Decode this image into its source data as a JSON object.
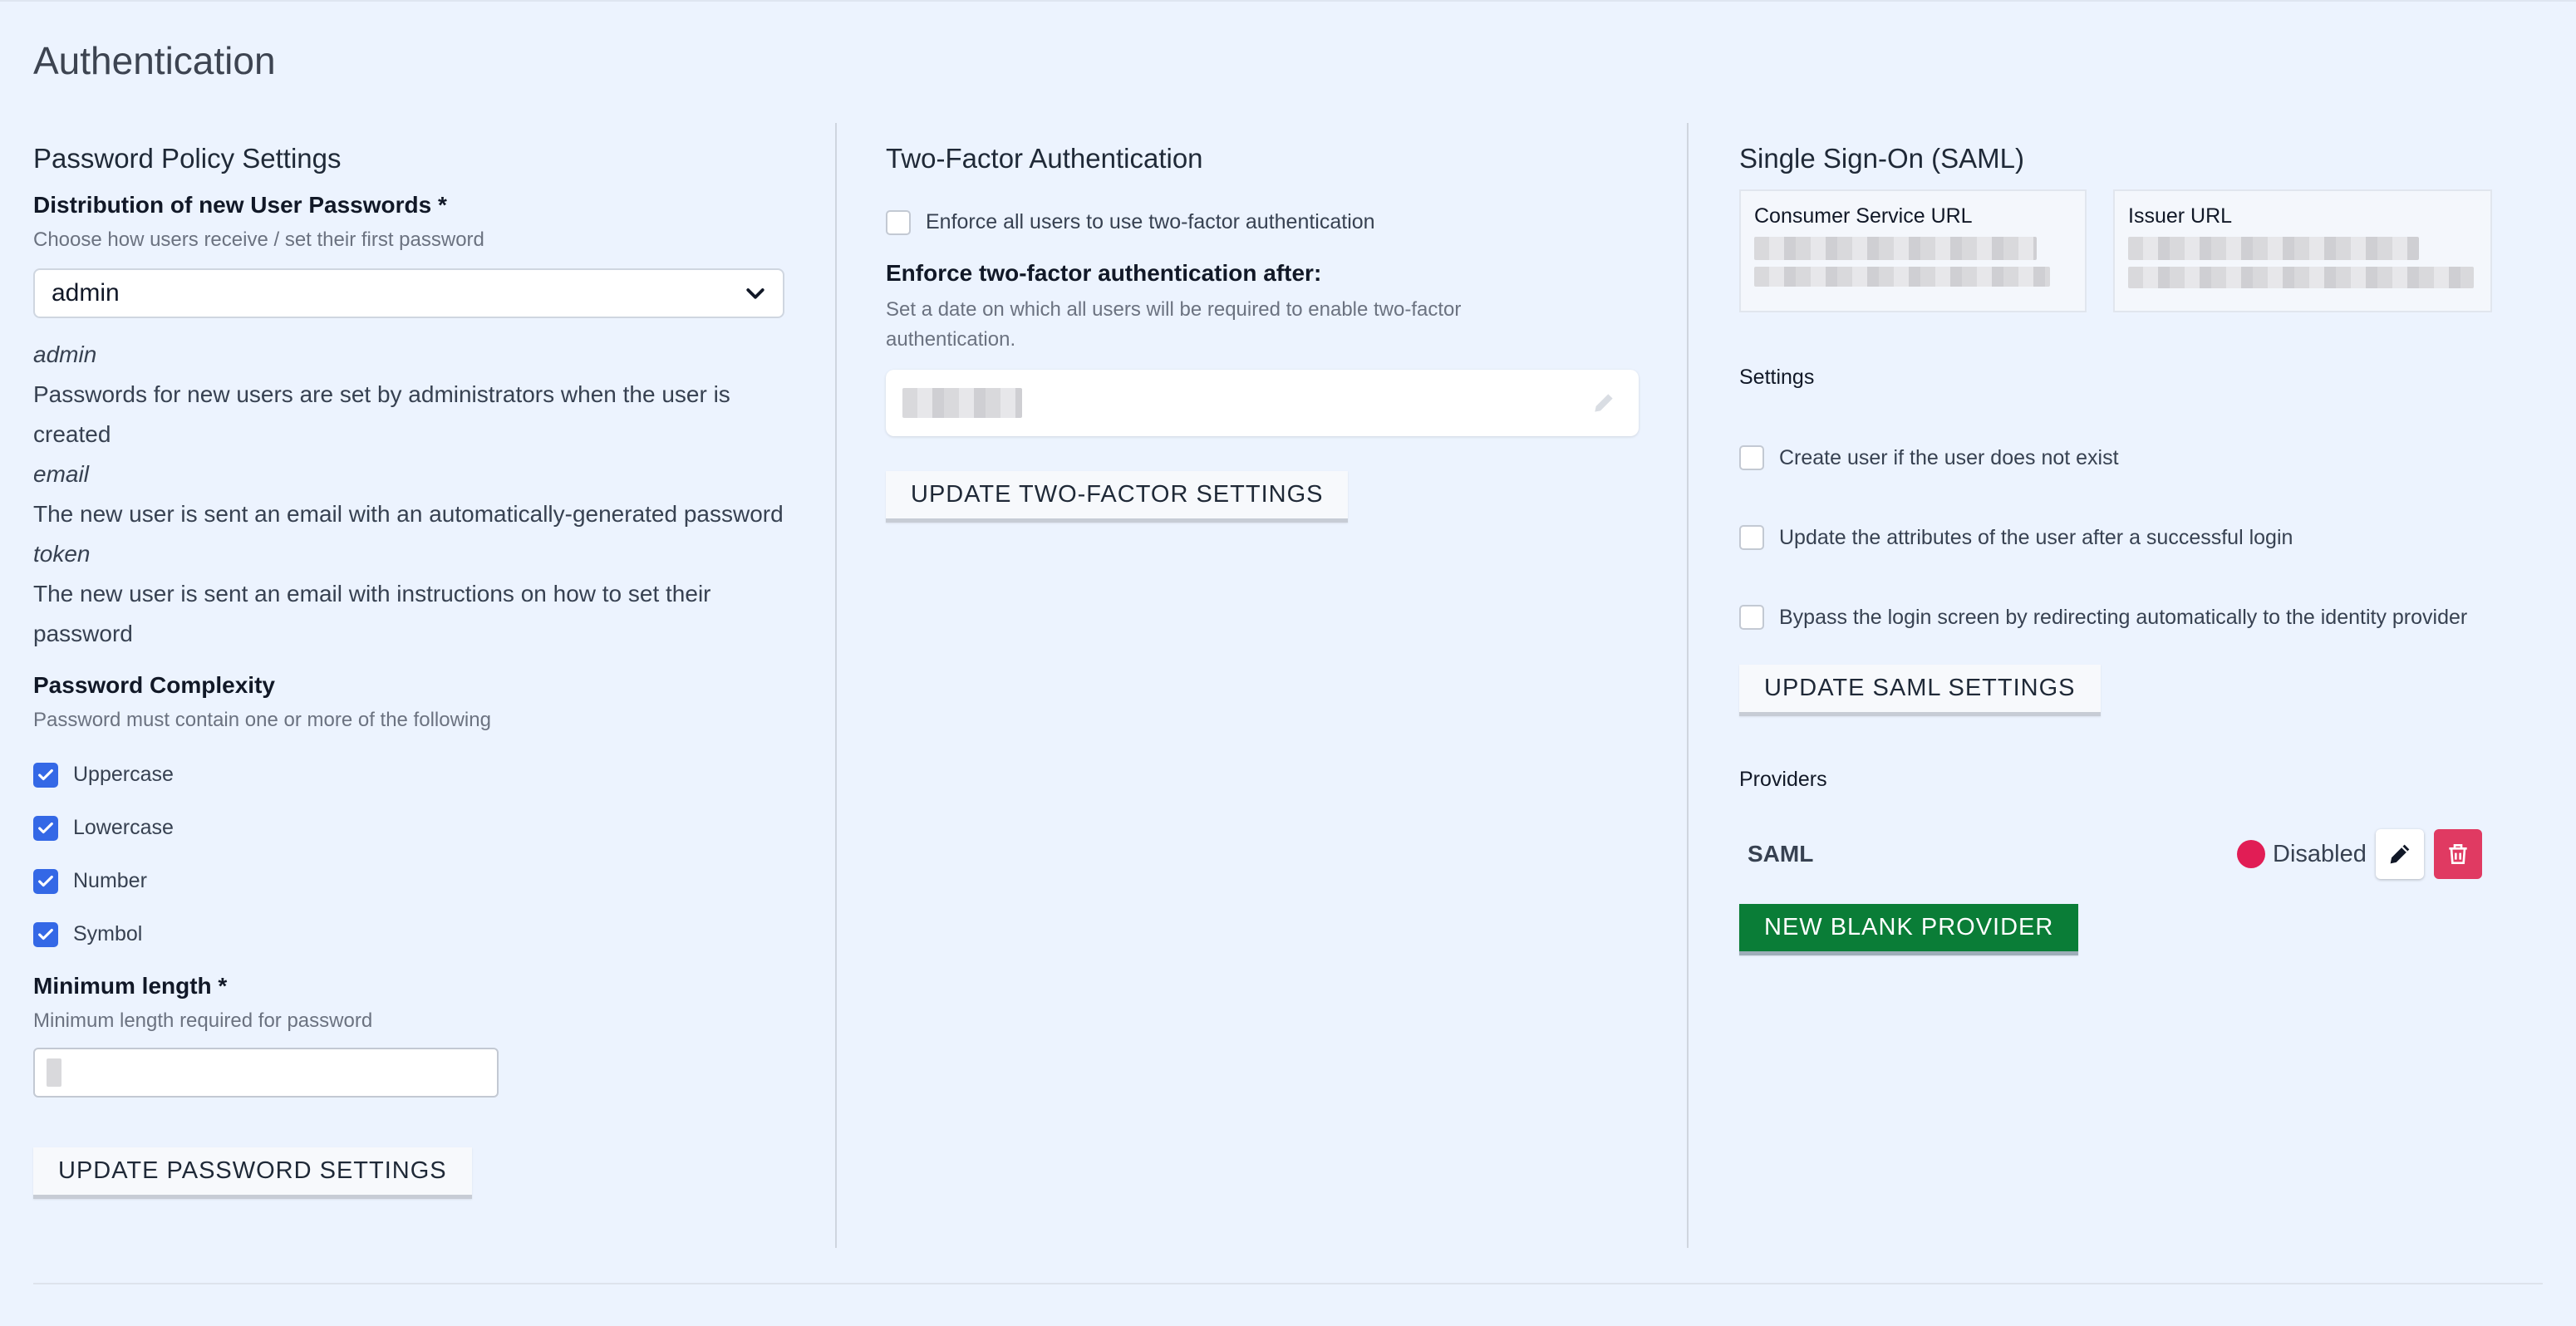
{
  "page": {
    "title": "Authentication"
  },
  "password_policy": {
    "title": "Password Policy Settings",
    "distribution_label": "Distribution of new User Passwords *",
    "distribution_help": "Choose how users receive / set their first password",
    "distribution_value": "admin",
    "descriptions": [
      {
        "term": "admin",
        "text": "Passwords for new users are set by administrators when the user is created"
      },
      {
        "term": "email",
        "text": "The new user is sent an email with an automatically-generated password"
      },
      {
        "term": "token",
        "text": "The new user is sent an email with instructions on how to set their password"
      }
    ],
    "complexity_label": "Password Complexity",
    "complexity_help": "Password must contain one or more of the following",
    "complexity_options": [
      {
        "label": "Uppercase",
        "checked": true
      },
      {
        "label": "Lowercase",
        "checked": true
      },
      {
        "label": "Number",
        "checked": true
      },
      {
        "label": "Symbol",
        "checked": true
      }
    ],
    "min_length_label": "Minimum length *",
    "min_length_help": "Minimum length required for password",
    "update_button": "UPDATE PASSWORD SETTINGS"
  },
  "two_factor": {
    "title": "Two-Factor Authentication",
    "enforce_all_label": "Enforce all users to use two-factor authentication",
    "enforce_all_checked": false,
    "enforce_after_label": "Enforce two-factor authentication after:",
    "enforce_after_help": "Set a date on which all users will be required to enable two-factor authentication.",
    "update_button": "UPDATE TWO-FACTOR SETTINGS"
  },
  "saml": {
    "title": "Single Sign-On (SAML)",
    "consumer_url_label": "Consumer Service URL",
    "issuer_url_label": "Issuer URL",
    "settings_label": "Settings",
    "options": [
      {
        "label": "Create user if the user does not exist",
        "checked": false
      },
      {
        "label": "Update the attributes of the user after a successful login",
        "checked": false
      },
      {
        "label": "Bypass the login screen by redirecting automatically to the identity provider",
        "checked": false
      }
    ],
    "update_button": "UPDATE SAML SETTINGS",
    "providers_label": "Providers",
    "providers": [
      {
        "name": "SAML",
        "status": "Disabled",
        "status_color": "#e11d55"
      }
    ],
    "new_provider_button": "NEW BLANK PROVIDER"
  },
  "colors": {
    "accent": "#3468e6",
    "success": "#0a7d37",
    "danger": "#e03a62",
    "background": "#ecf3fe"
  }
}
